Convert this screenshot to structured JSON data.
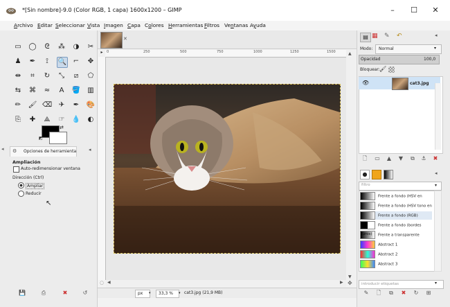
{
  "window": {
    "title": "*[Sin nombre]-9.0 (Color RGB, 1 capa) 1600x1200 – GIMP",
    "minimize": "–",
    "maximize": "☐",
    "close": "✕"
  },
  "menus": [
    "Archivo",
    "Editar",
    "Seleccionar",
    "Vista",
    "Imagen",
    "Capa",
    "Colores",
    "Herramientas",
    "Filtros",
    "Ventanas",
    "Ayuda"
  ],
  "menu_underline": [
    "A",
    "E",
    "S",
    "V",
    "I",
    "C",
    "o",
    "H",
    "F",
    "n",
    "y"
  ],
  "tool_options": {
    "tab_label": "Opciones de herramienta",
    "title": "Ampliación",
    "auto_resize": "Auto-redimensionar ventana",
    "direction_label": "Dirección (Ctrl)",
    "zoom_in": "Ampliar",
    "zoom_out": "Reducir"
  },
  "rulers": {
    "h_ticks": [
      "0",
      "250",
      "500",
      "750",
      "1000",
      "1250",
      "1500"
    ]
  },
  "status": {
    "unit": "px",
    "zoom": "33,3 %",
    "info": "cat3.jpg (21,9 MB)"
  },
  "layers": {
    "mode_label": "Modo:",
    "mode_value": "Normal",
    "opacity_label": "Opacidad",
    "opacity_value": "100,0",
    "lock_label": "Bloquear:",
    "layer_name": "cat3.jpg"
  },
  "gradients": {
    "filter_placeholder": "filtro",
    "items": [
      {
        "name": "Frente a fondo (HSV en sentido",
        "swatch": "linear-gradient(90deg,#000,#fff)"
      },
      {
        "name": "Frente a fondo (HSV tono en",
        "swatch": "linear-gradient(90deg,#000,#fff)"
      },
      {
        "name": "Frente a fondo (RGB)",
        "swatch": "linear-gradient(90deg,#000,#fff)"
      },
      {
        "name": "Frente a fondo (bordes duros)",
        "swatch": "linear-gradient(90deg,#000 50%,#fff 50%)"
      },
      {
        "name": "Frente a transparente",
        "swatch": "linear-gradient(90deg,#000,rgba(0,0,0,0))"
      },
      {
        "name": "Abstract 1",
        "swatch": "linear-gradient(90deg,#3a3aff,#ff3ad0,#ffd23a)"
      },
      {
        "name": "Abstract 2",
        "swatch": "linear-gradient(90deg,#ff2a2a,#2affd5,#ff2ad4)"
      },
      {
        "name": "Abstract 3",
        "swatch": "linear-gradient(90deg,#3aff5a,#ffde2a,#3a8aff)"
      }
    ],
    "tags_placeholder": "introducir etiquetas"
  },
  "colors": {
    "foreground": "#000000",
    "background": "#ffffff",
    "selection": "#cfe3f6"
  },
  "tools": [
    "rect-select",
    "ellipse-select",
    "free-select",
    "fuzzy-select",
    "color-select",
    "scissors-select",
    "foreground-select",
    "paths",
    "color-picker",
    "zoom",
    "measure",
    "move",
    "align",
    "crop",
    "rotate",
    "scale",
    "shear",
    "perspective",
    "flip",
    "cage-transform",
    "warp-transform",
    "text",
    "bucket-fill",
    "blend",
    "pencil",
    "paintbrush",
    "eraser",
    "airbrush",
    "ink",
    "mypaint",
    "clone",
    "heal",
    "perspective-clone",
    "smudge",
    "blur",
    "dodge-burn"
  ]
}
